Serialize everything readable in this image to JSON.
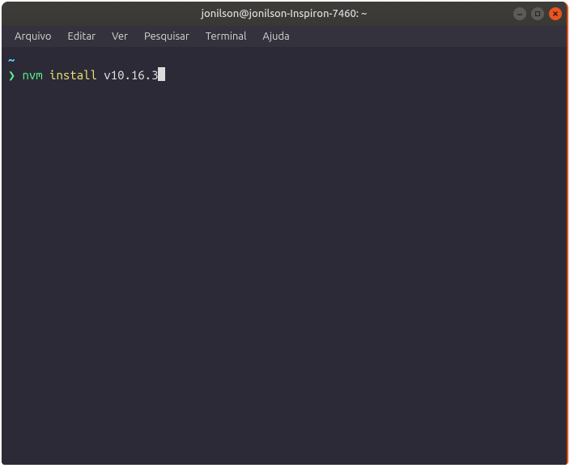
{
  "titlebar": {
    "title": "jonilson@jonilson-Inspiron-7460: ~"
  },
  "menubar": {
    "items": [
      {
        "label": "Arquivo"
      },
      {
        "label": "Editar"
      },
      {
        "label": "Ver"
      },
      {
        "label": "Pesquisar"
      },
      {
        "label": "Terminal"
      },
      {
        "label": "Ajuda"
      }
    ]
  },
  "terminal": {
    "cwd_indicator": "~",
    "prompt_symbol": "❯",
    "command_part1": "nvm",
    "command_part2": "install",
    "command_part3": "v10.16.3"
  }
}
